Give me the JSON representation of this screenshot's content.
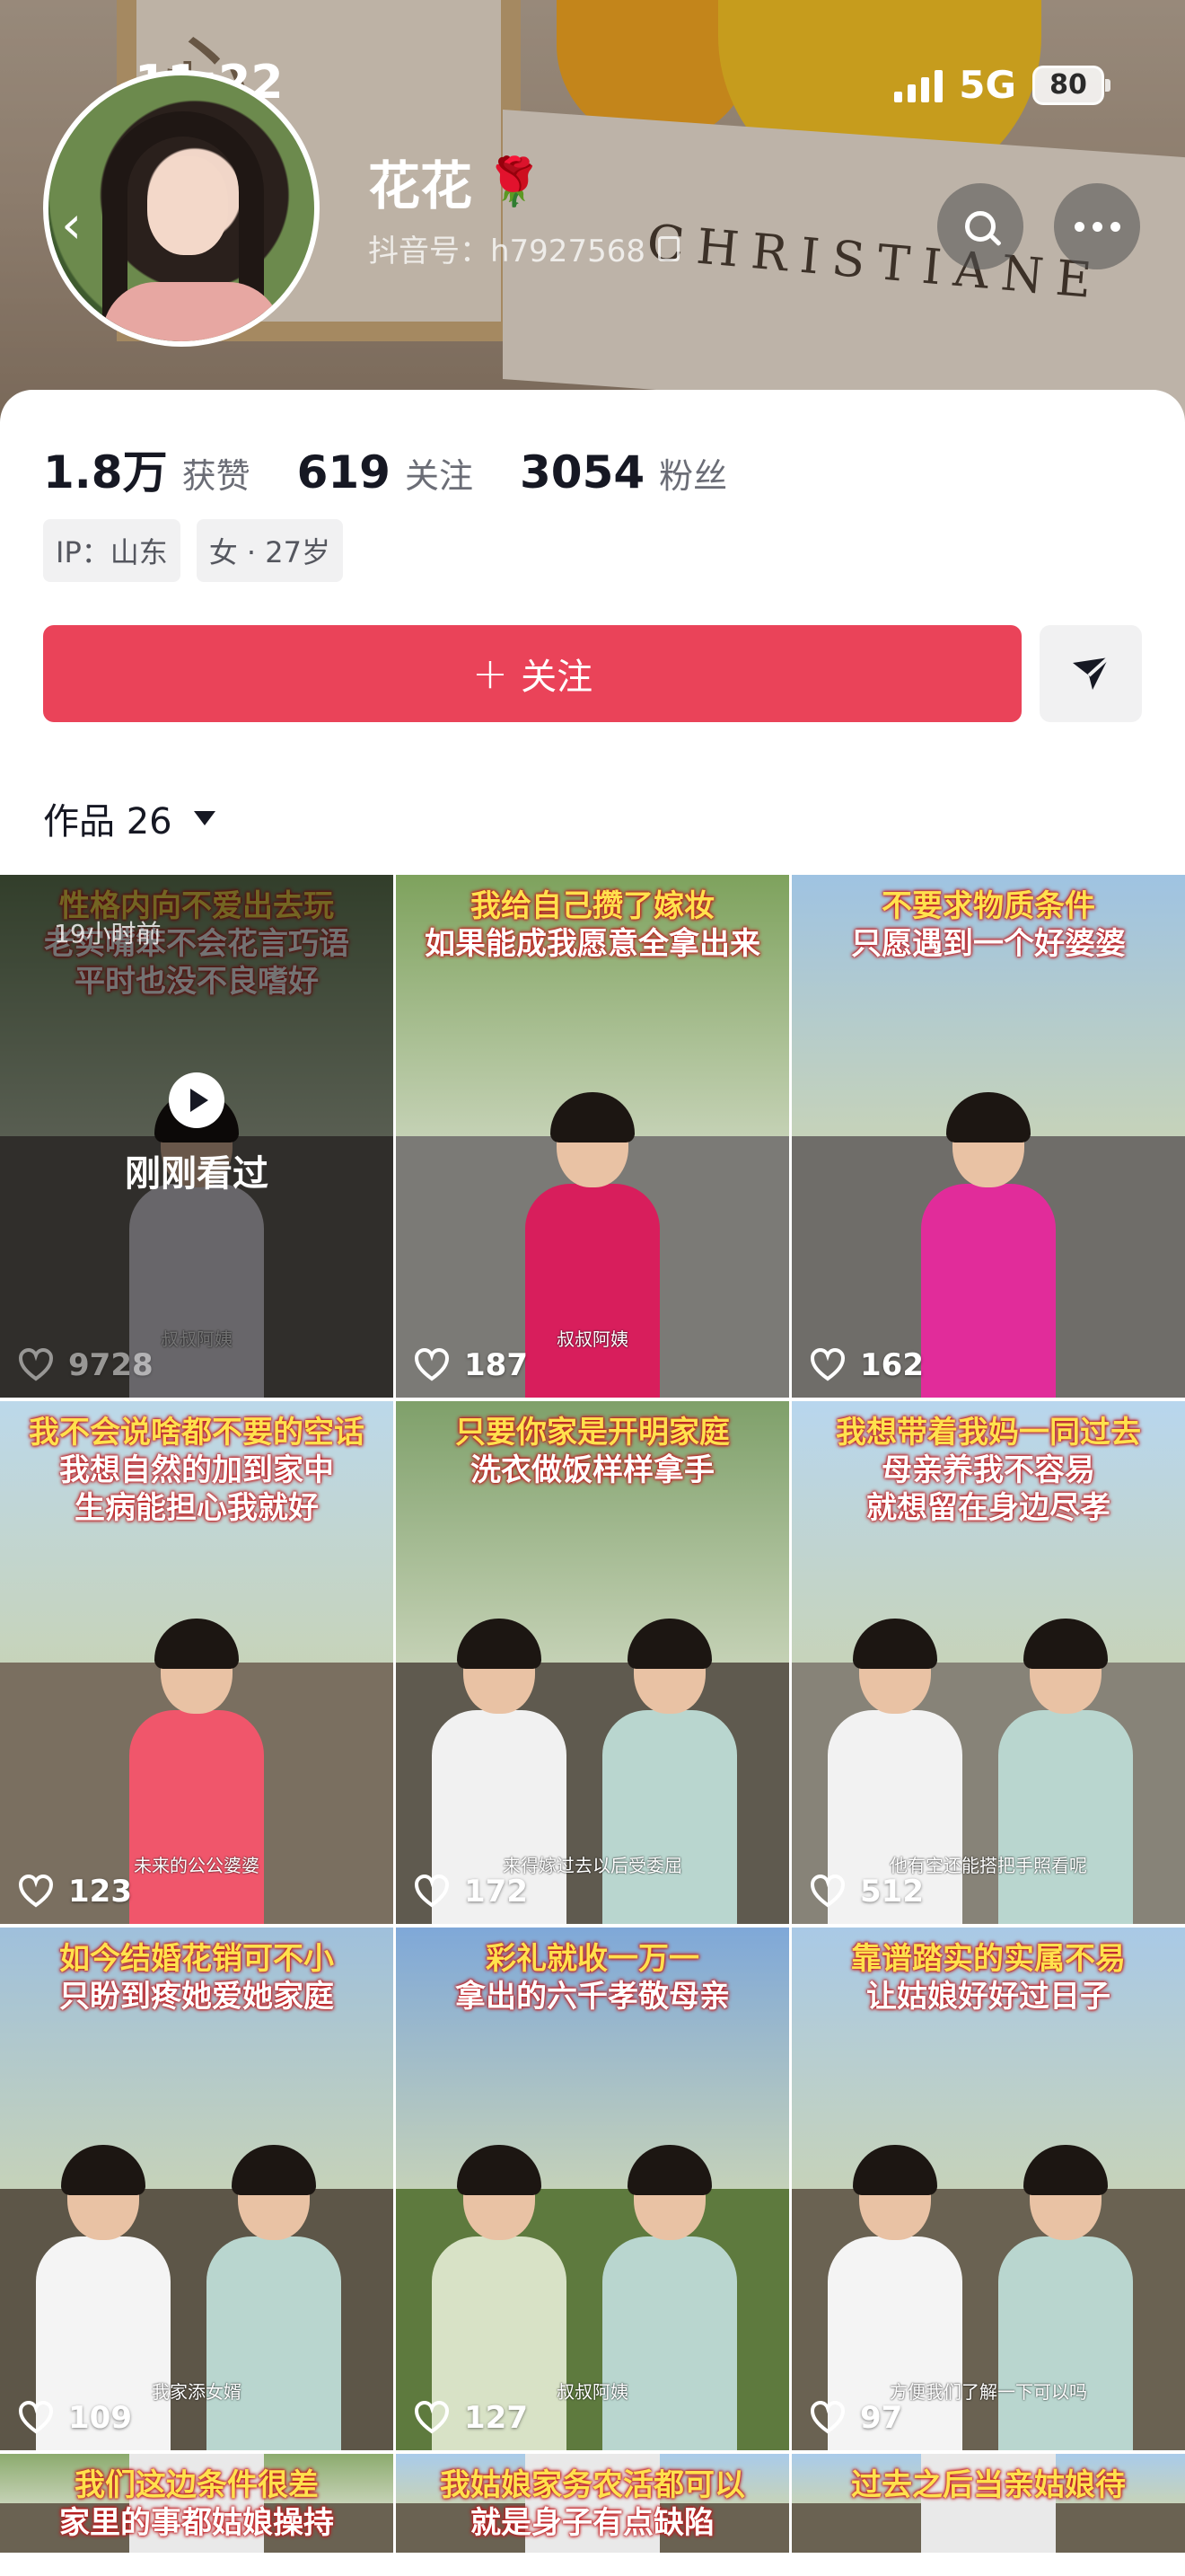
{
  "status_bar": {
    "time": "11:22",
    "network": "5G",
    "battery": "80"
  },
  "profile": {
    "nickname": "花花",
    "badge_emoji": "🌹",
    "douyin_id": "抖音号：h7927568",
    "stats": [
      {
        "value": "1.8万",
        "label": "获赞"
      },
      {
        "value": "619",
        "label": "关注"
      },
      {
        "value": "3054",
        "label": "粉丝"
      }
    ],
    "tags": [
      "IP：山东",
      "女 · 27岁"
    ],
    "follow_label": "关注",
    "banner_text": "CHRISTIANE"
  },
  "tabs": {
    "works_label": "作品 26"
  },
  "videos": [
    {
      "caption": [
        "性格内向不爱出去玩",
        "老实嘴笨不会花言巧语",
        "平时也没不良嗜好"
      ],
      "likes": "9728",
      "subtitle": "叔叔阿姨",
      "watched": true,
      "watched_label": "刚刚看过",
      "time_ago": "19小时前"
    },
    {
      "caption": [
        "我给自己攒了嫁妆",
        "如果能成我愿意全拿出来"
      ],
      "likes": "187",
      "subtitle": "叔叔阿姨"
    },
    {
      "caption": [
        "不要求物质条件",
        "只愿遇到一个好婆婆"
      ],
      "likes": "162",
      "subtitle": ""
    },
    {
      "caption": [
        "我不会说啥都不要的空话",
        "我想自然的加到家中",
        "生病能担心我就好"
      ],
      "likes": "123",
      "subtitle": "未来的公公婆婆"
    },
    {
      "caption": [
        "只要你家是开明家庭",
        "洗衣做饭样样拿手"
      ],
      "likes": "172",
      "subtitle": "来得嫁过去以后受委屈"
    },
    {
      "caption": [
        "我想带着我妈一同过去",
        "母亲养我不容易",
        "就想留在身边尽孝"
      ],
      "likes": "512",
      "subtitle": "他有空还能搭把手照看呢"
    },
    {
      "caption": [
        "如今结婚花销可不小",
        "只盼到疼她爱她家庭"
      ],
      "likes": "109",
      "subtitle": "我家添女婿"
    },
    {
      "caption": [
        "彩礼就收一万一",
        "拿出的六千孝敬母亲"
      ],
      "likes": "127",
      "subtitle": "叔叔阿姨"
    },
    {
      "caption": [
        "靠谱踏实的实属不易",
        "让姑娘好好过日子"
      ],
      "likes": "97",
      "subtitle": "方便我们了解一下可以吗"
    },
    {
      "caption": [
        "我们这边条件很差",
        "家里的事都姑娘操持"
      ],
      "likes": "",
      "subtitle": ""
    },
    {
      "caption": [
        "我姑娘家务农活都可以",
        "就是身子有点缺陷"
      ],
      "likes": "",
      "subtitle": ""
    },
    {
      "caption": [
        "过去之后当亲姑娘待"
      ],
      "likes": "",
      "subtitle": ""
    }
  ],
  "colors": {
    "accent": "#ea4359",
    "caption_stroke": "#c0171b",
    "caption_yellow": "#ffe14d"
  }
}
